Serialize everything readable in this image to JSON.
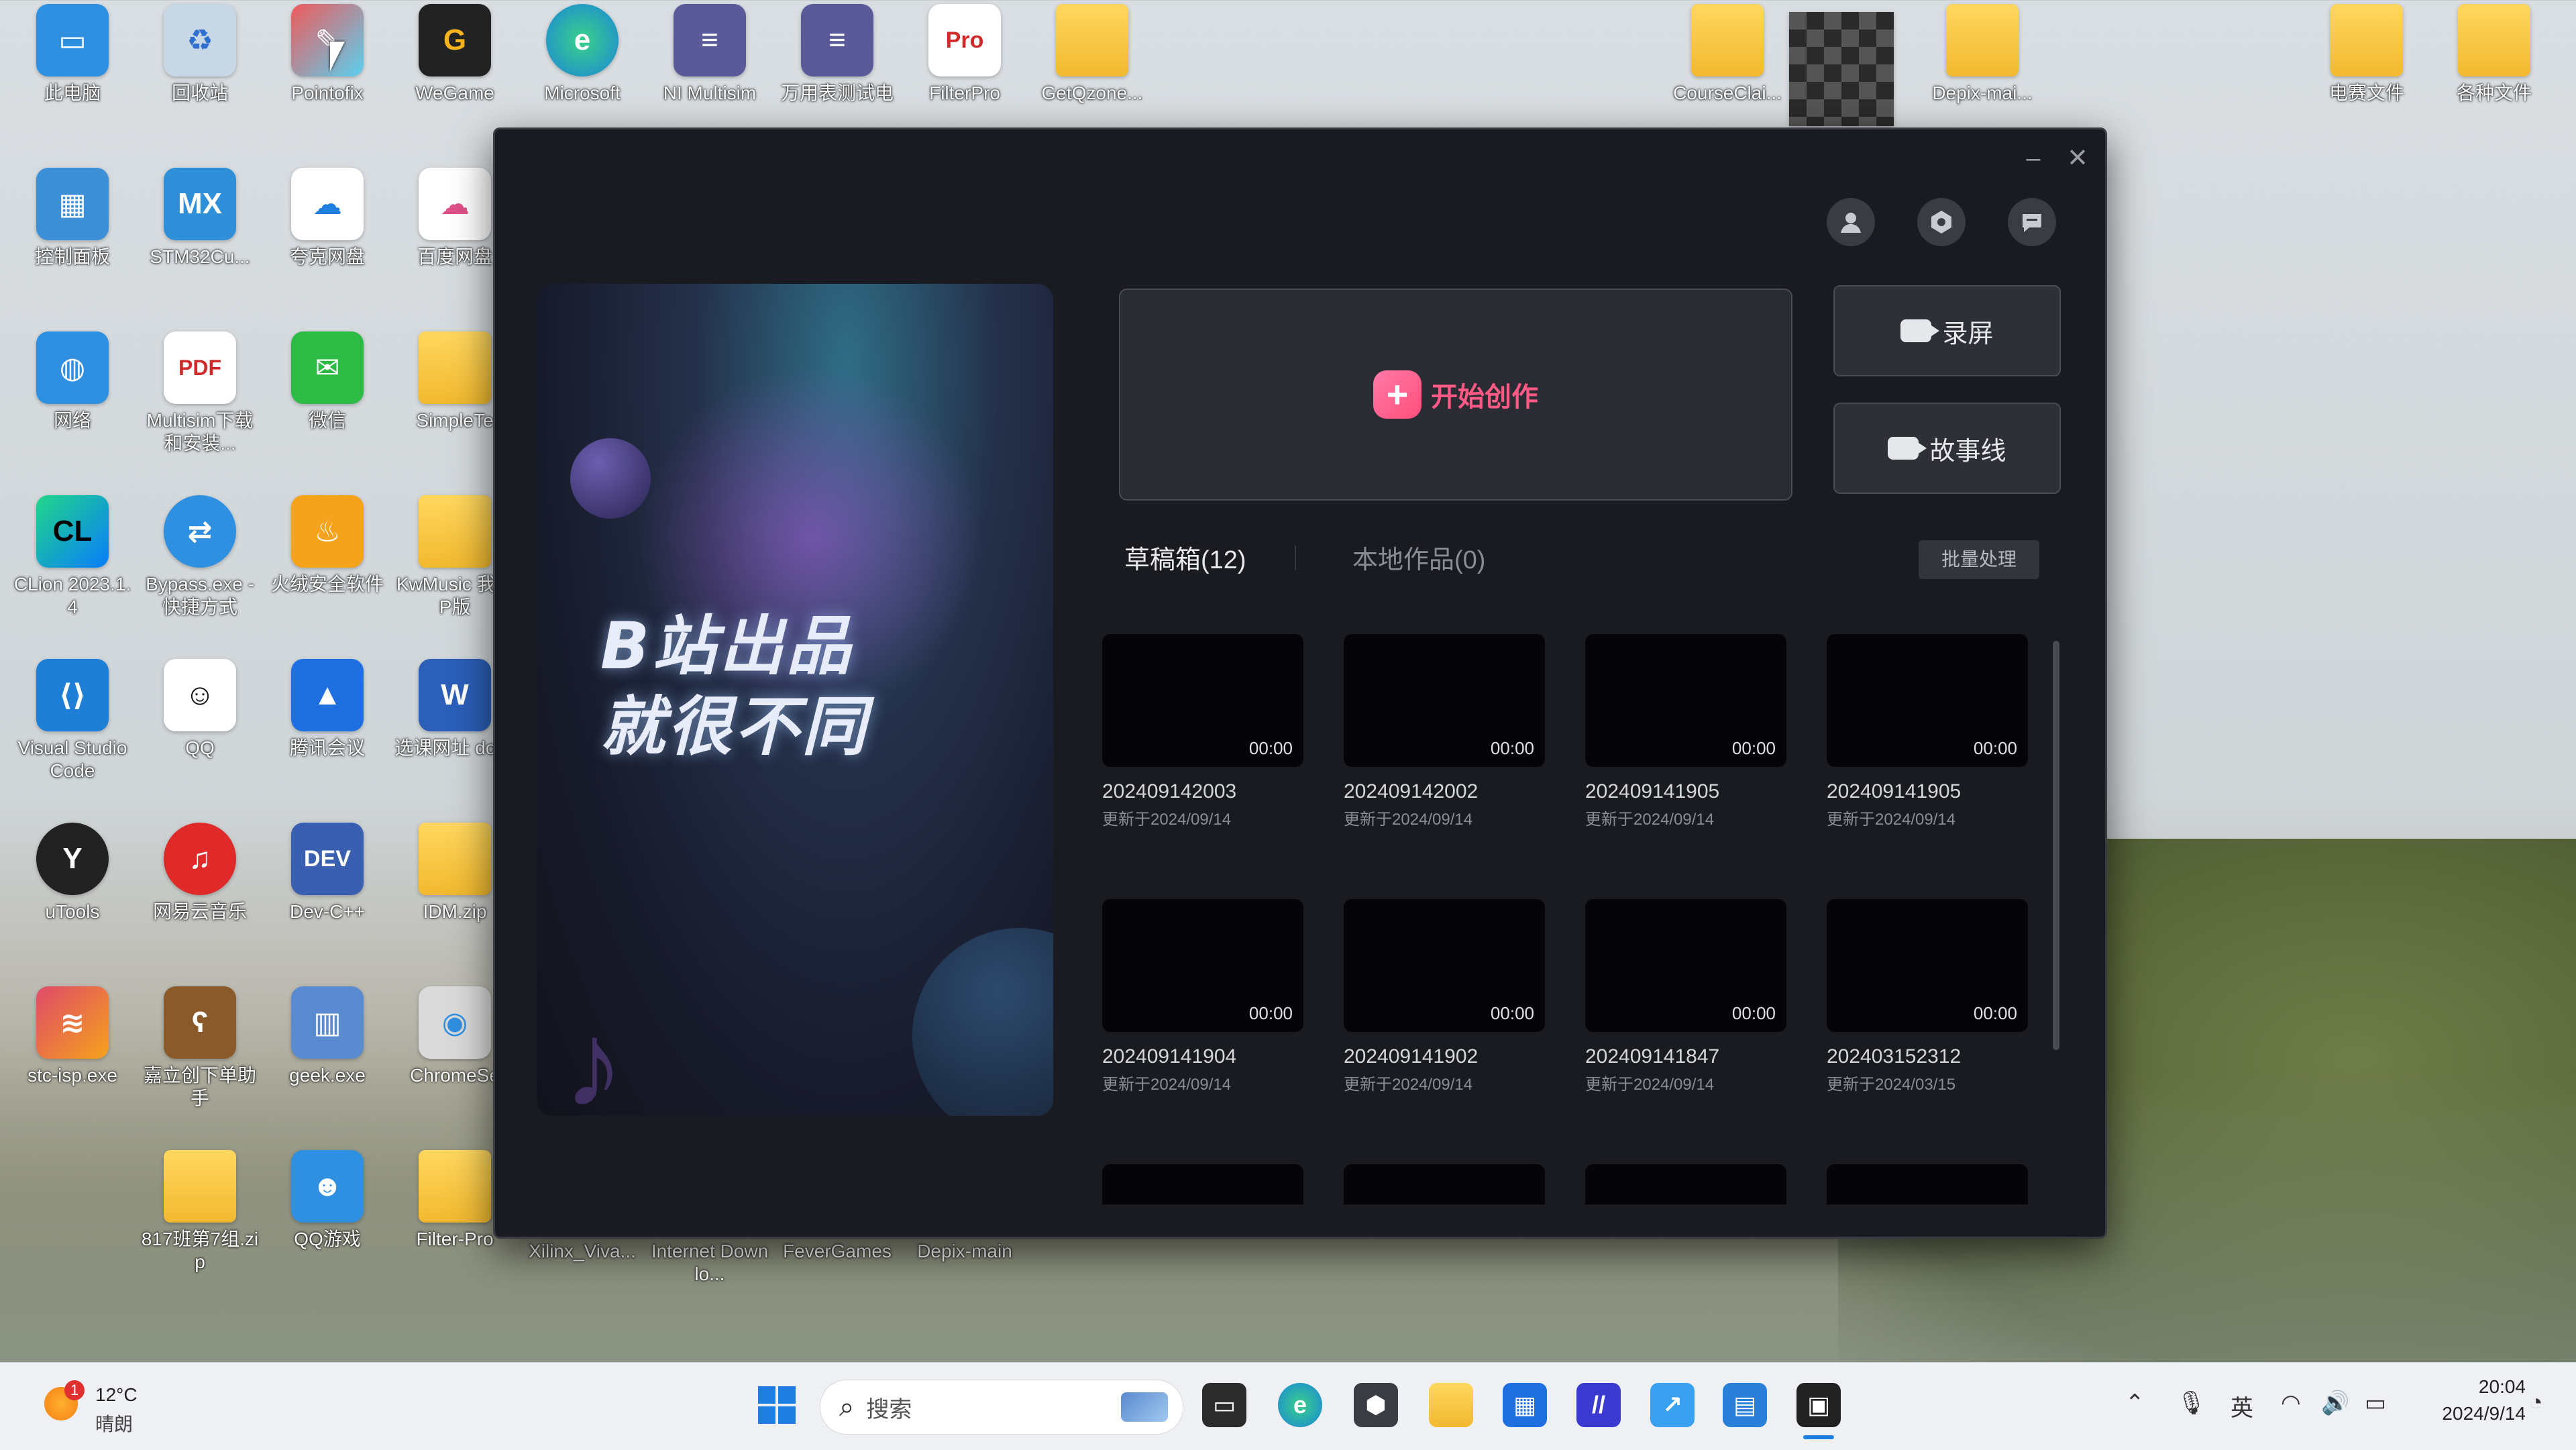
{
  "desktop": {
    "icons": [
      {
        "label": "此电脑",
        "icon": "computer-icon",
        "color": "#2f8fe0"
      },
      {
        "label": "回收站",
        "icon": "recycle-bin-icon",
        "color": "#c8d7e6"
      },
      {
        "label": "Pointofix",
        "icon": "pointofix-icon",
        "color": "#f05a5a"
      },
      {
        "label": "WeGame",
        "icon": "wegame-icon",
        "color": "#222222"
      },
      {
        "label": "Microsoft",
        "icon": "edge-icon",
        "color": "#1a86d8"
      },
      {
        "label": "NI Multisim",
        "icon": "multisim-icon",
        "color": "#5a5a9a"
      },
      {
        "label": "万用表测试电",
        "icon": "multimeter-icon",
        "color": "#5a5a9a"
      },
      {
        "label": "FilterPro",
        "icon": "filterpro-icon",
        "color": "#ffffff"
      },
      {
        "label": "GetQzone...",
        "icon": "folder-icon",
        "color": "#f2b92f"
      },
      {
        "label": "控制面板",
        "icon": "control-panel-icon",
        "color": "#3d8fd8"
      },
      {
        "label": "STM32Cu...",
        "icon": "stm32-icon",
        "color": "#2f8fd8"
      },
      {
        "label": "夸克网盘",
        "icon": "quark-cloud-icon",
        "color": "#1f7fe0"
      },
      {
        "label": "百度网盘",
        "icon": "baidu-cloud-icon",
        "color": "#ffffff"
      },
      {
        "label": "网络",
        "icon": "network-icon",
        "color": "#2f8fe0"
      },
      {
        "label": "Multisim下载和安装...",
        "icon": "pdf-icon",
        "color": "#ffffff"
      },
      {
        "label": "微信",
        "icon": "wechat-icon",
        "color": "#2dbb45"
      },
      {
        "label": "SimpleTe",
        "icon": "folder-icon",
        "color": "#f2b92f"
      },
      {
        "label": "CLion 2023.1.4",
        "icon": "clion-icon",
        "color": "#1f1f1f"
      },
      {
        "label": "Bypass.exe - 快捷方式",
        "icon": "bypass-icon",
        "color": "#2f8fe0"
      },
      {
        "label": "火绒安全软件",
        "icon": "huorong-icon",
        "color": "#f5a21c"
      },
      {
        "label": "KwMusic 我VIP版",
        "icon": "folder-icon",
        "color": "#f2b92f"
      },
      {
        "label": "Visual Studio Code",
        "icon": "vscode-icon",
        "color": "#1f7fd6"
      },
      {
        "label": "QQ",
        "icon": "qq-icon",
        "color": "#ffffff"
      },
      {
        "label": "腾讯会议",
        "icon": "tencent-meeting-icon",
        "color": "#1f6fe0"
      },
      {
        "label": "选课网址 docx",
        "icon": "word-icon",
        "color": "#2b5fb8"
      },
      {
        "label": "uTools",
        "icon": "utools-icon",
        "color": "#222222"
      },
      {
        "label": "网易云音乐",
        "icon": "netease-music-icon",
        "color": "#e02a2a"
      },
      {
        "label": "Dev-C++",
        "icon": "devcpp-icon",
        "color": "#3a5fb0"
      },
      {
        "label": "IDM.zip",
        "icon": "zip-folder-icon",
        "color": "#f2b92f"
      },
      {
        "label": "stc-isp.exe",
        "icon": "stc-isp-icon",
        "color": "#e04a6a"
      },
      {
        "label": "嘉立创下单助手",
        "icon": "jlc-icon",
        "color": "#8a5a2a"
      },
      {
        "label": "geek.exe",
        "icon": "geek-icon",
        "color": "#5a8ad0"
      },
      {
        "label": "ChromeSe",
        "icon": "chrome-setup-icon",
        "color": "#dadada"
      },
      {
        "label": "817班第7组.zip",
        "icon": "zip-folder-icon",
        "color": "#f2b92f"
      },
      {
        "label": "QQ游戏",
        "icon": "qq-game-icon",
        "color": "#2f8fe0"
      },
      {
        "label": "Filter-Pro",
        "icon": "folder-icon",
        "color": "#f2b92f"
      },
      {
        "label": "Xilinx_Viva...",
        "icon": "",
        "color": ""
      },
      {
        "label": "Internet Downlo...",
        "icon": "",
        "color": ""
      },
      {
        "label": "FeverGames",
        "icon": "",
        "color": ""
      },
      {
        "label": "Depix-main",
        "icon": "",
        "color": ""
      },
      {
        "label": "CourseClai...",
        "icon": "folder-icon",
        "color": "#f2b92f"
      },
      {
        "label": "Depix-mai...",
        "icon": "zip-folder-icon",
        "color": "#f2b92f"
      },
      {
        "label": "电赛文件",
        "icon": "folder-icon",
        "color": "#f2b92f"
      },
      {
        "label": "各种文件",
        "icon": "folder-icon",
        "color": "#f2b92f"
      }
    ]
  },
  "app": {
    "banner_text_line1": "B站出品",
    "banner_text_line2": "就很不同",
    "create_label": "开始创作",
    "record_label": "录屏",
    "story_label": "故事线",
    "tabs": [
      {
        "label": "草稿箱(12)",
        "active": true
      },
      {
        "label": "本地作品(0)",
        "active": false
      }
    ],
    "batch_label": "批量处理",
    "drafts": [
      {
        "name": "202409142003",
        "updated": "更新于2024/09/14",
        "duration": "00:00"
      },
      {
        "name": "202409142002",
        "updated": "更新于2024/09/14",
        "duration": "00:00"
      },
      {
        "name": "202409141905",
        "updated": "更新于2024/09/14",
        "duration": "00:00"
      },
      {
        "name": "202409141905",
        "updated": "更新于2024/09/14",
        "duration": "00:00"
      },
      {
        "name": "202409141904",
        "updated": "更新于2024/09/14",
        "duration": "00:00"
      },
      {
        "name": "202409141902",
        "updated": "更新于2024/09/14",
        "duration": "00:00"
      },
      {
        "name": "202409141847",
        "updated": "更新于2024/09/14",
        "duration": "00:00"
      },
      {
        "name": "202403152312",
        "updated": "更新于2024/03/15",
        "duration": "00:00"
      }
    ],
    "accent_color": "#ff5a86"
  },
  "taskbar": {
    "weather_temp": "12°C",
    "weather_desc": "晴朗",
    "weather_badge": "1",
    "search_placeholder": "搜索",
    "ime_label": "英",
    "time": "20:04",
    "date": "2024/9/14"
  }
}
